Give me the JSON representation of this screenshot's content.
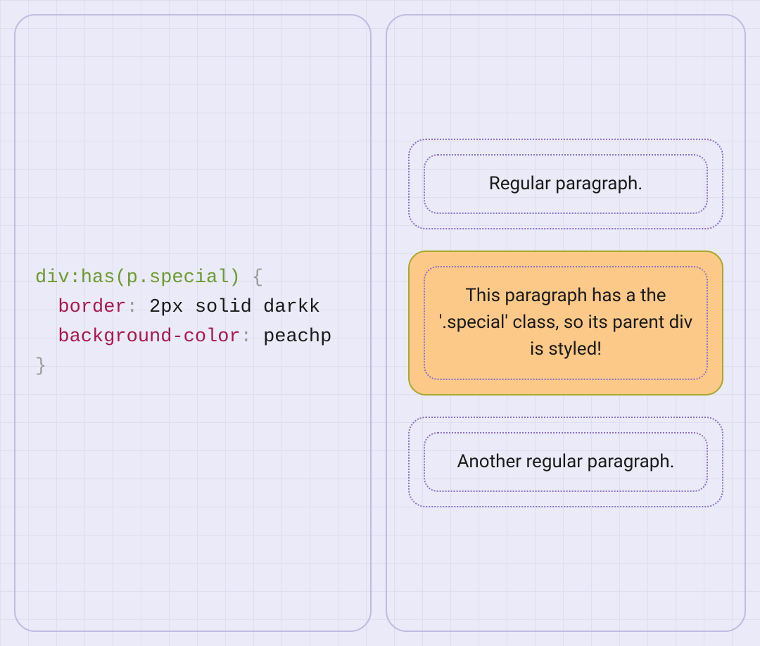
{
  "code": {
    "selector": "div:has(p.special)",
    "open_brace": " {",
    "line1_indent": "  ",
    "line1_property": "border",
    "line1_colon": ": ",
    "line1_value": "2px solid darkk",
    "line2_indent": "  ",
    "line2_property": "background-color",
    "line2_colon": ": ",
    "line2_value": "peachp",
    "close_brace": "}"
  },
  "preview": {
    "box1_text": "Regular paragraph.",
    "box2_text": "This paragraph has a the '.special' class, so its parent div is styled!",
    "box3_text": "Another regular paragraph."
  }
}
